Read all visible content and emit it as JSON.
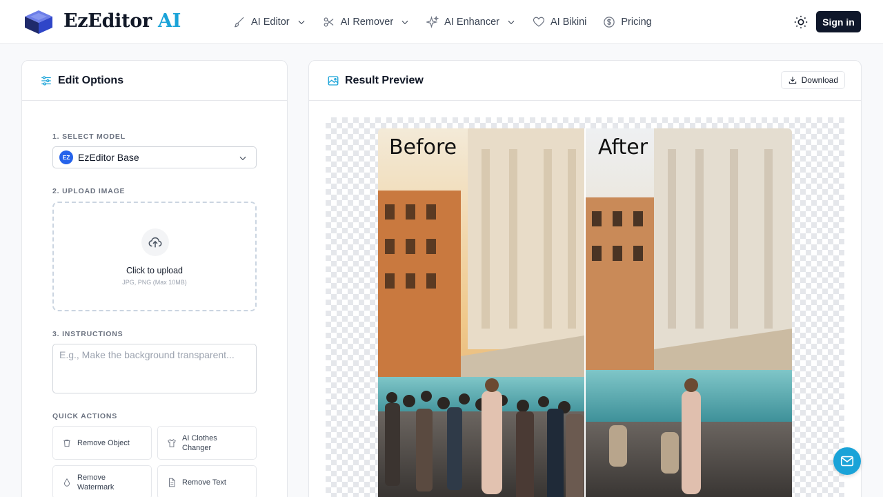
{
  "brand": {
    "name": "EzEditor",
    "suffix": "AI",
    "accent_color": "#1aa3d8"
  },
  "nav": {
    "items": [
      {
        "label": "AI Editor",
        "icon": "brush-icon",
        "has_dropdown": true
      },
      {
        "label": "AI Remover",
        "icon": "scissors-icon",
        "has_dropdown": true
      },
      {
        "label": "AI Enhancer",
        "icon": "sparkles-icon",
        "has_dropdown": true
      },
      {
        "label": "AI Bikini",
        "icon": "heart-icon",
        "has_dropdown": false
      },
      {
        "label": "Pricing",
        "icon": "dollar-icon",
        "has_dropdown": false
      }
    ],
    "sign_in": "Sign in"
  },
  "edit_panel": {
    "title": "Edit Options",
    "model": {
      "label": "1. SELECT MODEL",
      "badge": "EZ",
      "selected": "EzEditor Base"
    },
    "upload": {
      "label": "2. UPLOAD IMAGE",
      "text": "Click to upload",
      "hint": "JPG, PNG (Max 10MB)"
    },
    "instructions": {
      "label": "3. INSTRUCTIONS",
      "value": "",
      "placeholder": "E.g., Make the background transparent..."
    },
    "quick_actions": {
      "label": "QUICK ACTIONS",
      "items": [
        {
          "label": "Remove Object",
          "icon": "trash-icon"
        },
        {
          "label": "AI Clothes Changer",
          "icon": "shirt-icon"
        },
        {
          "label": "Remove Watermark",
          "icon": "droplet-icon"
        },
        {
          "label": "Remove Text",
          "icon": "file-text-icon"
        }
      ]
    }
  },
  "preview_panel": {
    "title": "Result Preview",
    "download": "Download",
    "before_label": "Before",
    "after_label": "After"
  }
}
